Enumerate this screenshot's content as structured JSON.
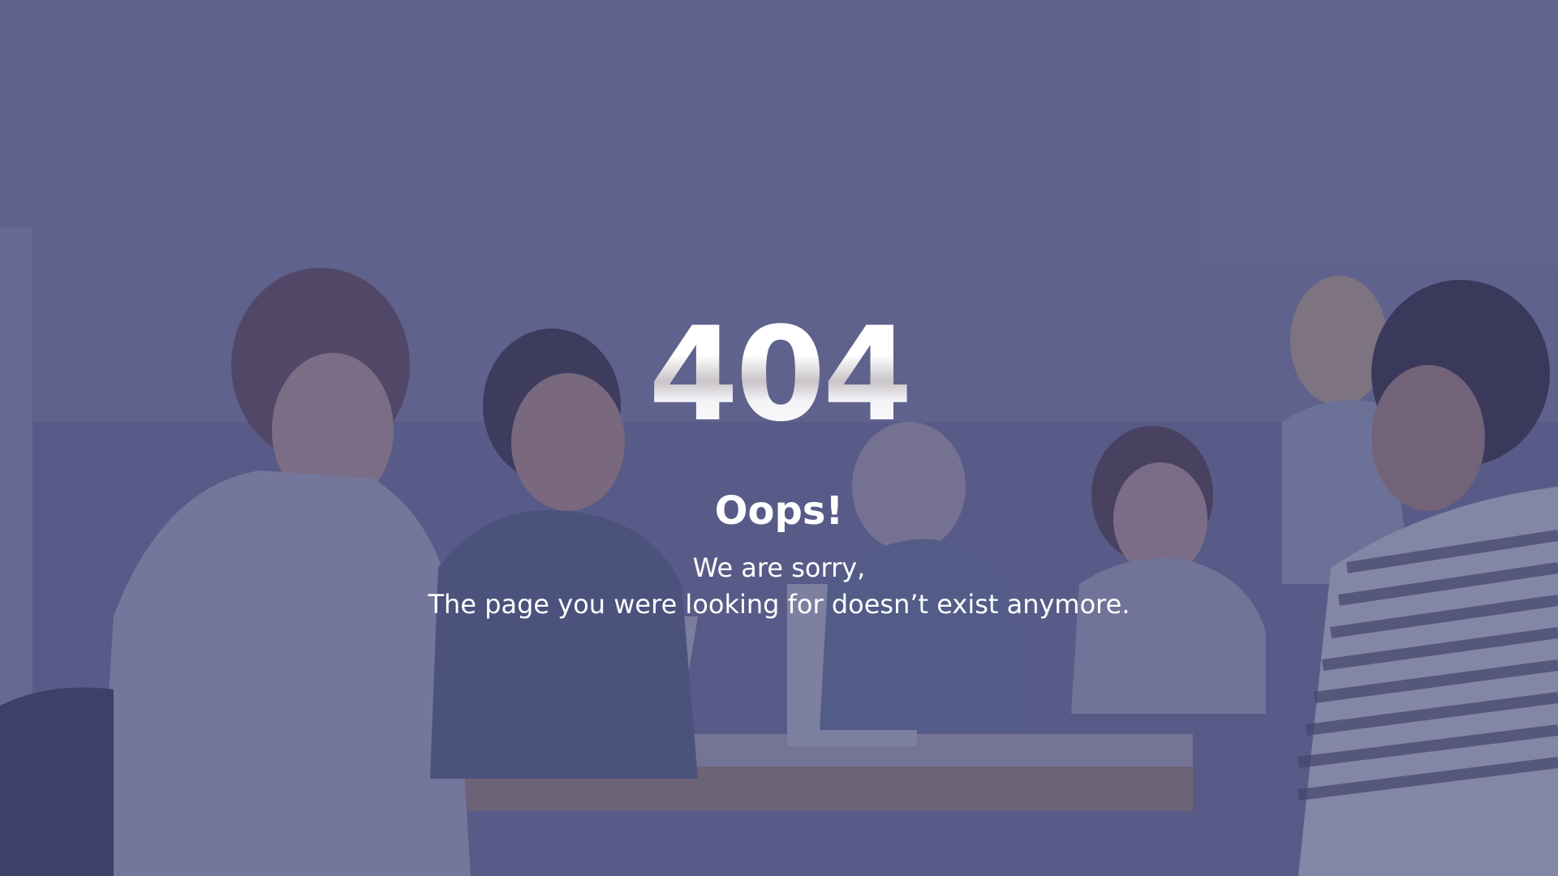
{
  "colors": {
    "background": "#4e5277",
    "overlay": "#3c3e6e",
    "text": "#ffffff"
  },
  "error": {
    "code_digits": [
      "4",
      "0",
      "4"
    ]
  },
  "heading": {
    "title": "Oops!"
  },
  "message": {
    "line1": "We are sorry,",
    "line2": "The page you were looking for doesn’t exist anymore."
  }
}
